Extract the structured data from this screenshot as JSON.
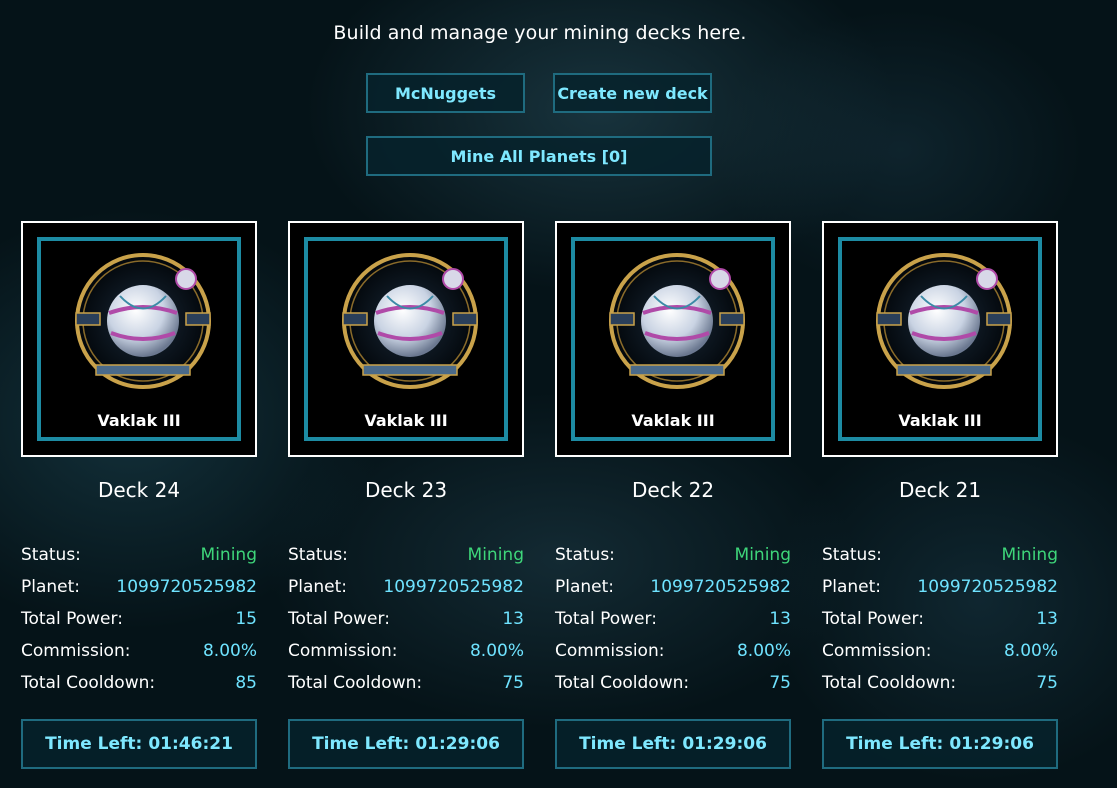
{
  "header": {
    "subtitle": "Build and manage your mining decks here.",
    "deck_button_label": "McNuggets",
    "create_button_label": "Create new deck",
    "mine_all_label": "Mine All Planets [0]"
  },
  "labels": {
    "status": "Status:",
    "planet": "Planet:",
    "total_power": "Total Power:",
    "commission": "Commission:",
    "total_cooldown": "Total Cooldown:",
    "time_left": "Time Left:"
  },
  "colors": {
    "accent": "#7ee8ff",
    "value": "#6fe3ff",
    "status_mining": "#3ed67a",
    "card_border": "#1d8ba3"
  },
  "decks": [
    {
      "title": "Deck 24",
      "planet_name": "Vaklak III",
      "status": "Mining",
      "planet_id": "1099720525982",
      "total_power": "15",
      "commission": "8.00%",
      "total_cooldown": "85",
      "time_left": "01:46:21"
    },
    {
      "title": "Deck 23",
      "planet_name": "Vaklak III",
      "status": "Mining",
      "planet_id": "1099720525982",
      "total_power": "13",
      "commission": "8.00%",
      "total_cooldown": "75",
      "time_left": "01:29:06"
    },
    {
      "title": "Deck 22",
      "planet_name": "Vaklak III",
      "status": "Mining",
      "planet_id": "1099720525982",
      "total_power": "13",
      "commission": "8.00%",
      "total_cooldown": "75",
      "time_left": "01:29:06"
    },
    {
      "title": "Deck 21",
      "planet_name": "Vaklak III",
      "status": "Mining",
      "planet_id": "1099720525982",
      "total_power": "13",
      "commission": "8.00%",
      "total_cooldown": "75",
      "time_left": "01:29:06"
    }
  ]
}
